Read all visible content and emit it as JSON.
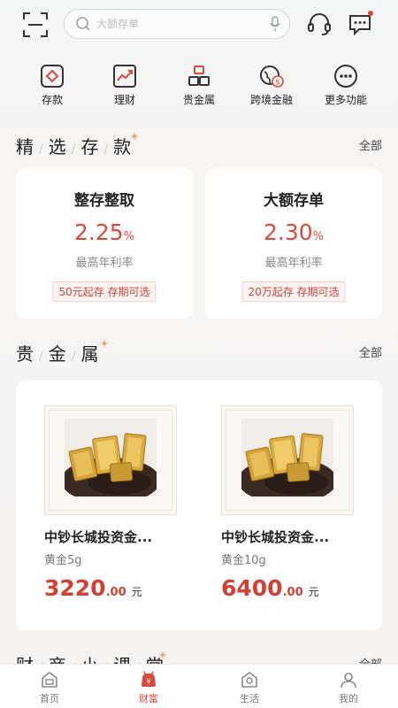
{
  "topbar": {
    "search_placeholder": "大额存单",
    "icons": [
      "scan-icon",
      "search-icon",
      "microphone-icon",
      "headset-icon",
      "message-icon"
    ],
    "has_unread": true
  },
  "quick_nav": [
    {
      "label": "存款",
      "icon": "deposit-icon"
    },
    {
      "label": "理财",
      "icon": "trend-chart-icon"
    },
    {
      "label": "贵金属",
      "icon": "gold-bars-icon"
    },
    {
      "label": "跨境金融",
      "icon": "globe-dollar-icon"
    },
    {
      "label": "更多功能",
      "icon": "more-icon"
    }
  ],
  "deposits": {
    "title_chars": [
      "精",
      "选",
      "存",
      "款"
    ],
    "more_label": "全部",
    "items": [
      {
        "name": "整存整取",
        "rate": "2.25",
        "rate_unit": "%",
        "sub": "最高年利率",
        "tag": "50元起存 存期可选"
      },
      {
        "name": "大额存单",
        "rate": "2.30",
        "rate_unit": "%",
        "sub": "最高年利率",
        "tag": "20万起存 存期可选"
      }
    ]
  },
  "gold": {
    "title_chars": [
      "贵",
      "金",
      "属"
    ],
    "more_label": "全部",
    "items": [
      {
        "name": "中钞长城投资金...",
        "spec": "黄金5g",
        "price_int": "3220",
        "price_dec": ".00",
        "unit": "元"
      },
      {
        "name": "中钞长城投资金...",
        "spec": "黄金10g",
        "price_int": "6400",
        "price_dec": ".00",
        "unit": "元"
      }
    ]
  },
  "classroom": {
    "title_chars": [
      "财",
      "商",
      "小",
      "课",
      "堂"
    ],
    "more_label": "全部"
  },
  "bottom_nav": [
    {
      "label": "首页",
      "icon": "home-icon",
      "active": false
    },
    {
      "label": "财富",
      "icon": "wealth-icon",
      "active": true
    },
    {
      "label": "生活",
      "icon": "life-icon",
      "active": false
    },
    {
      "label": "我的",
      "icon": "profile-icon",
      "active": false
    }
  ],
  "colors": {
    "accent": "#d8493e",
    "text": "#222222",
    "muted": "#888888"
  }
}
